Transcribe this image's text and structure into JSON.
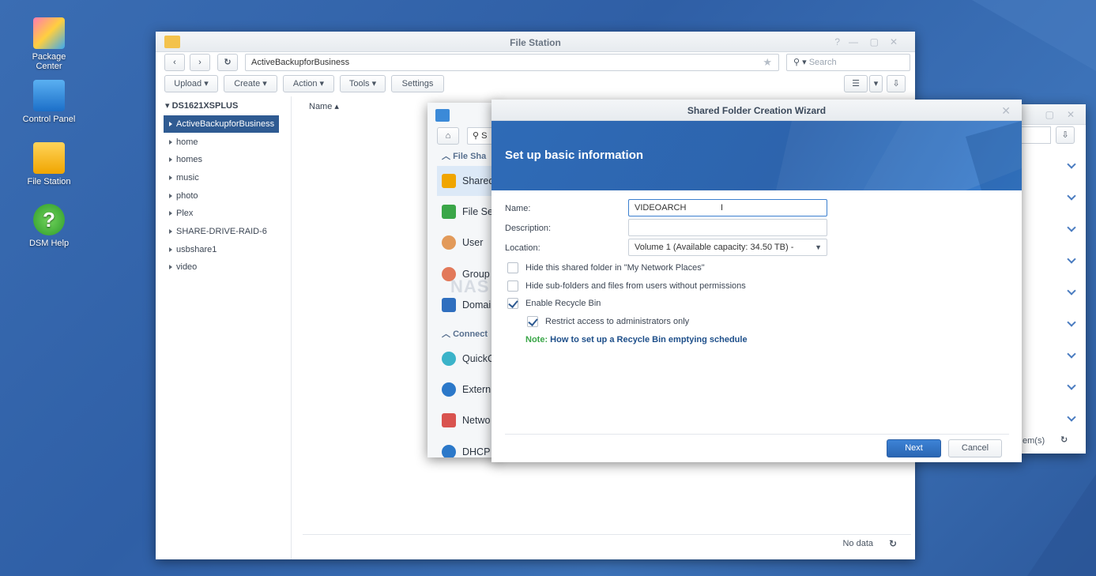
{
  "desktop": {
    "icons": [
      {
        "label": "Package Center"
      },
      {
        "label": "Control Panel"
      },
      {
        "label": "File Station"
      },
      {
        "label": "DSM Help"
      }
    ]
  },
  "file_station": {
    "title": "File Station",
    "path": "ActiveBackupforBusiness",
    "search_placeholder": "Search",
    "toolbar": {
      "upload": "Upload",
      "create": "Create",
      "action": "Action",
      "tools": "Tools",
      "settings": "Settings"
    },
    "tree_root": "DS1621XSPLUS",
    "tree_items": [
      "ActiveBackupforBusiness",
      "home",
      "homes",
      "music",
      "photo",
      "Plex",
      "SHARE-DRIVE-RAID-6",
      "usbshare1",
      "video"
    ],
    "column_name": "Name",
    "status": "No data"
  },
  "control_panel": {
    "search_placeholder": "S",
    "section_file": "File Sha",
    "section_connect": "Connect",
    "items_file": [
      {
        "label": "Shared",
        "icon": "shared-folder-icon",
        "color": "#f0a500"
      },
      {
        "label": "File Se",
        "icon": "file-services-icon",
        "color": "#3aa648"
      },
      {
        "label": "User",
        "icon": "user-icon",
        "color": "#e29a5a"
      },
      {
        "label": "Group",
        "icon": "group-icon",
        "color": "#e2795a"
      },
      {
        "label": "Domai",
        "icon": "domain-icon",
        "color": "#2f6fbf"
      }
    ],
    "items_connect": [
      {
        "label": "QuickC",
        "icon": "quickconnect-icon",
        "color": "#3bb3c9"
      },
      {
        "label": "Extern",
        "icon": "external-access-icon",
        "color": "#2b78c9"
      },
      {
        "label": "Netwo",
        "icon": "network-icon",
        "color": "#d9534f"
      },
      {
        "label": "DHCP S",
        "icon": "dhcp-icon",
        "color": "#2b78c9"
      }
    ]
  },
  "back_panel": {
    "items_label": "em(s)"
  },
  "wizard": {
    "title": "Shared Folder Creation Wizard",
    "heading": "Set up basic information",
    "name_label": "Name:",
    "name_value": "VIDEOARCH",
    "description_label": "Description:",
    "description_value": "",
    "location_label": "Location:",
    "location_value": "Volume 1 (Available capacity:  34.50 TB) -",
    "options": [
      {
        "label": "Hide this shared folder in \"My Network Places\"",
        "checked": false
      },
      {
        "label": "Hide sub-folders and files from users without permissions",
        "checked": false
      },
      {
        "label": "Enable Recycle Bin",
        "checked": true
      },
      {
        "label": "Restrict access to administrators only",
        "checked": true
      }
    ],
    "note_label": "Note:",
    "note_link": "How to set up a Recycle Bin emptying schedule",
    "next": "Next",
    "cancel": "Cancel",
    "accent": "#2f6fbf"
  },
  "watermark": "NAS COMPARES"
}
